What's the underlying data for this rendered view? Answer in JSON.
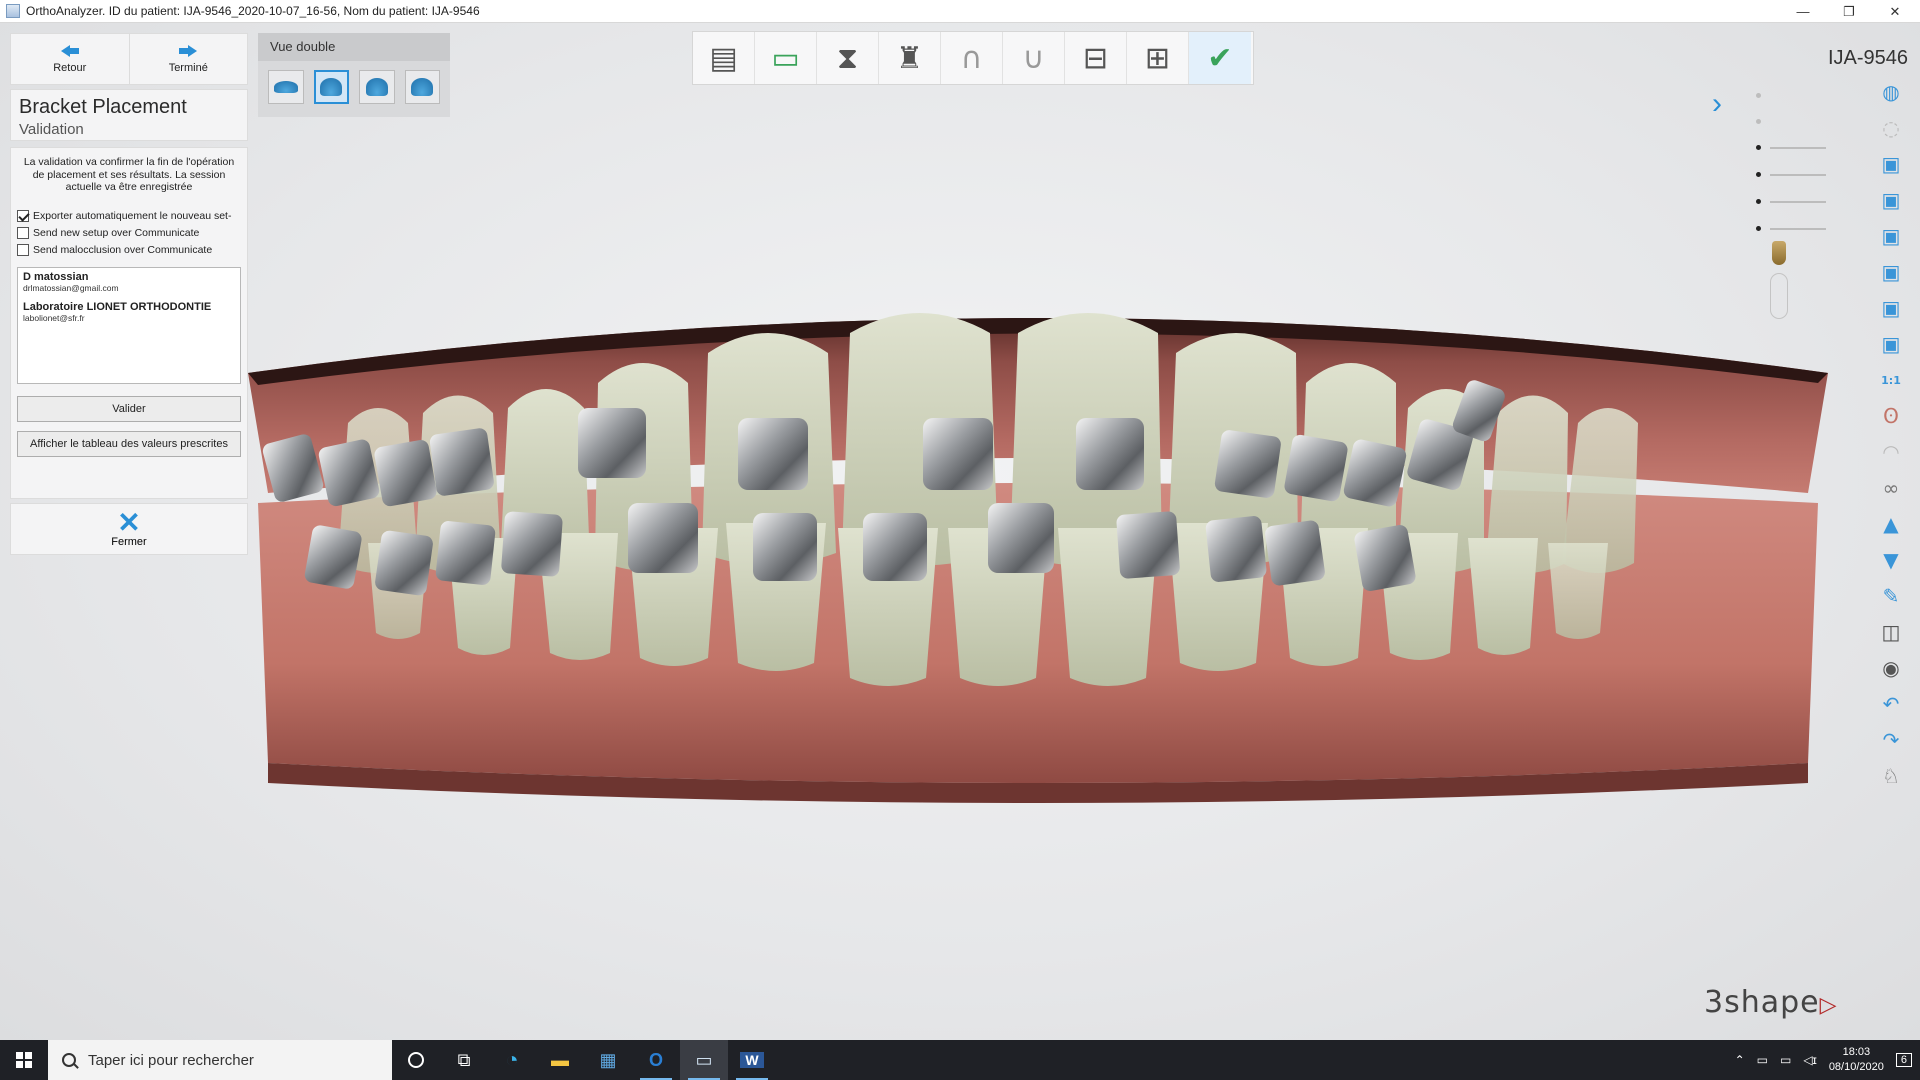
{
  "window": {
    "title": "OrthoAnalyzer. ID du patient: IJA-9546_2020-10-07_16-56, Nom du patient:  IJA-9546",
    "minimize": "—",
    "restore": "❐",
    "close": "✕"
  },
  "nav": {
    "back_label": "Retour",
    "done_label": "Terminé"
  },
  "step": {
    "title": "Bracket Placement",
    "subtitle": "Validation"
  },
  "validation": {
    "description": "La validation va confirmer la fin de l'opération de placement et ses résultats. La session actuelle va être enregistrée",
    "options": [
      {
        "label": "Exporter automatiquement le nouveau set-",
        "checked": true
      },
      {
        "label": "Send new setup over Communicate",
        "checked": false
      },
      {
        "label": "Send malocclusion over Communicate",
        "checked": false
      }
    ],
    "contacts": [
      {
        "name": "D matossian",
        "email": "drlmatossian@gmail.com"
      },
      {
        "name": "Laboratoire LIONET ORTHODONTIE",
        "email": "labolionet@sfr.fr"
      }
    ],
    "validate_label": "Valider",
    "table_label": "Afficher le tableau des valeurs prescrites",
    "close_label": "Fermer"
  },
  "view_panel": {
    "title": "Vue double",
    "selected_index": 1
  },
  "toolbar": {
    "items": [
      {
        "name": "model-base-icon",
        "glyph": "▤"
      },
      {
        "name": "occlusion-map-icon",
        "glyph": "▭"
      },
      {
        "name": "tooth-axis-icon",
        "glyph": "⧗"
      },
      {
        "name": "tooth-root-icon",
        "glyph": "♜"
      },
      {
        "name": "upper-arch-icon",
        "glyph": "∩"
      },
      {
        "name": "lower-arch-icon",
        "glyph": "∪"
      },
      {
        "name": "bracket-upper-icon",
        "glyph": "⊟"
      },
      {
        "name": "bracket-lower-icon",
        "glyph": "⊞"
      },
      {
        "name": "bracket-validate-icon",
        "glyph": "✔"
      }
    ]
  },
  "patient_id": "IJA-9546",
  "logo": {
    "text": "3shape",
    "accent": "#b22a2a"
  },
  "right_tools": [
    {
      "name": "shading-icon",
      "glyph": "◍"
    },
    {
      "name": "texture-icon",
      "glyph": "◌"
    },
    {
      "name": "view-front-icon",
      "glyph": "▣"
    },
    {
      "name": "view-back-icon",
      "glyph": "▣"
    },
    {
      "name": "view-left-icon",
      "glyph": "▣"
    },
    {
      "name": "view-right-icon",
      "glyph": "▣"
    },
    {
      "name": "view-top-icon",
      "glyph": "▣"
    },
    {
      "name": "view-bottom-icon",
      "glyph": "▣"
    },
    {
      "name": "scale-1-1-icon",
      "glyph": "1:1"
    },
    {
      "name": "gum-icon",
      "glyph": "ʘ"
    },
    {
      "name": "cast-icon",
      "glyph": "◠"
    },
    {
      "name": "link-icon",
      "glyph": "∞"
    },
    {
      "name": "upper-jaw-icon",
      "glyph": "▲"
    },
    {
      "name": "lower-jaw-icon",
      "glyph": "▼"
    },
    {
      "name": "measure-icon",
      "glyph": "✎"
    },
    {
      "name": "section-icon",
      "glyph": "◫"
    },
    {
      "name": "camera-icon",
      "glyph": "◉"
    },
    {
      "name": "undo-icon",
      "glyph": "↶"
    },
    {
      "name": "redo-icon",
      "glyph": "↷"
    },
    {
      "name": "tooth-icon",
      "glyph": "♘"
    }
  ],
  "taskbar": {
    "search_placeholder": "Taper ici pour rechercher",
    "time": "18:03",
    "date": "08/10/2020",
    "notifications": "6"
  },
  "colors": {
    "accent": "#2a8fd6",
    "gum": "#c2736b",
    "tooth": "#c9cdb4",
    "bracket": "#8c8f93"
  }
}
